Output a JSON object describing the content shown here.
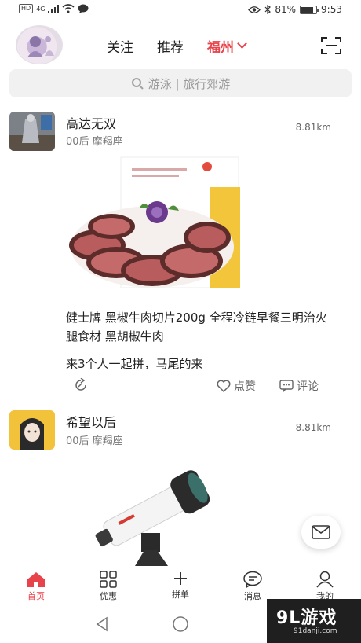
{
  "status_bar": {
    "carrier_badge": "HD",
    "network": "4G",
    "battery": "81%",
    "battery_level": 0.81,
    "time": "9:53"
  },
  "header": {
    "tabs": [
      {
        "label": "关注",
        "active": false
      },
      {
        "label": "推荐",
        "active": false
      },
      {
        "label": "福州",
        "active": true
      }
    ]
  },
  "search": {
    "placeholder": "游泳 | 旅行郊游"
  },
  "posts": [
    {
      "name": "高达无双",
      "meta": "00后 摩羯座",
      "distance": "8.81km",
      "product_title": "健士牌 黑椒牛肉切片200g 全程冷链早餐三明治火腿食材 黑胡椒牛肉",
      "text": "来3个人一起拼，马尾的来",
      "like_label": "点赞",
      "comment_label": "评论"
    },
    {
      "name": "希望以后",
      "meta": "00后 摩羯座",
      "distance": "8.81km"
    }
  ],
  "bottom_nav": [
    {
      "label": "首页",
      "icon": "home-icon",
      "active": true
    },
    {
      "label": "优惠",
      "icon": "grid-icon",
      "active": false
    },
    {
      "label": "拼单",
      "icon": "plus-icon",
      "active": false
    },
    {
      "label": "消息",
      "icon": "chat-icon",
      "active": false
    },
    {
      "label": "我的",
      "icon": "user-icon",
      "active": false
    }
  ],
  "watermark": {
    "brand": "9L游戏",
    "site": "91danji.com"
  },
  "colors": {
    "accent": "#e8424a"
  }
}
